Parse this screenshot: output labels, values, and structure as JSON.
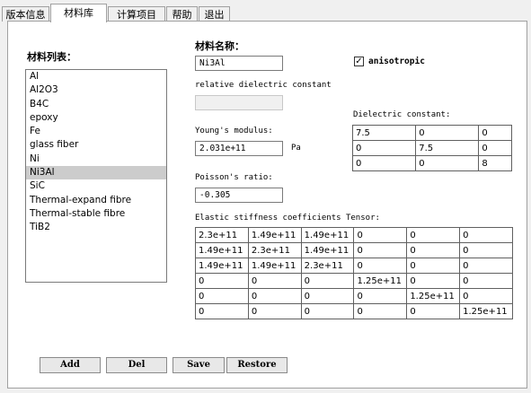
{
  "tabs": [
    {
      "label": "版本信息"
    },
    {
      "label": "材料库"
    },
    {
      "label": "计算项目"
    },
    {
      "label": "帮助"
    },
    {
      "label": "退出"
    }
  ],
  "material_list": {
    "title": "材料列表：",
    "items": [
      "Al",
      "Al2O3",
      "B4C",
      "epoxy",
      "Fe",
      "glass fiber",
      "Ni",
      "Ni3Al",
      "SiC",
      "Thermal-expand fibre",
      "Thermal-stable fibre",
      "TiB2"
    ],
    "selected": "Ni3Al"
  },
  "material_name": {
    "label": "材料名称：",
    "value": "Ni3Al"
  },
  "anisotropic": {
    "label": "anisotropic",
    "checked": true,
    "check_glyph": "✓"
  },
  "relative_dielectric": {
    "label": "relative dielectric constant",
    "value": ""
  },
  "youngs_modulus": {
    "label": "Young's modulus:",
    "value": "2.031e+11",
    "unit": "Pa"
  },
  "poissons_ratio": {
    "label": "Poisson's ratio:",
    "value": "-0.305"
  },
  "dielectric_constant": {
    "label": "Dielectric constant:",
    "rows": [
      [
        "7.5",
        "0",
        "0"
      ],
      [
        "0",
        "7.5",
        "0"
      ],
      [
        "0",
        "0",
        "8"
      ]
    ]
  },
  "stiffness_tensor": {
    "label": "Elastic stiffness coefficients Tensor:",
    "rows": [
      [
        "2.3e+11",
        "1.49e+11",
        "1.49e+11",
        "0",
        "0",
        "0"
      ],
      [
        "1.49e+11",
        "2.3e+11",
        "1.49e+11",
        "0",
        "0",
        "0"
      ],
      [
        "1.49e+11",
        "1.49e+11",
        "2.3e+11",
        "0",
        "0",
        "0"
      ],
      [
        "0",
        "0",
        "0",
        "1.25e+11",
        "0",
        "0"
      ],
      [
        "0",
        "0",
        "0",
        "0",
        "1.25e+11",
        "0"
      ],
      [
        "0",
        "0",
        "0",
        "0",
        "0",
        "1.25e+11"
      ]
    ]
  },
  "buttons": {
    "add": "Add",
    "del": "Del",
    "save": "Save",
    "restore": "Restore"
  }
}
